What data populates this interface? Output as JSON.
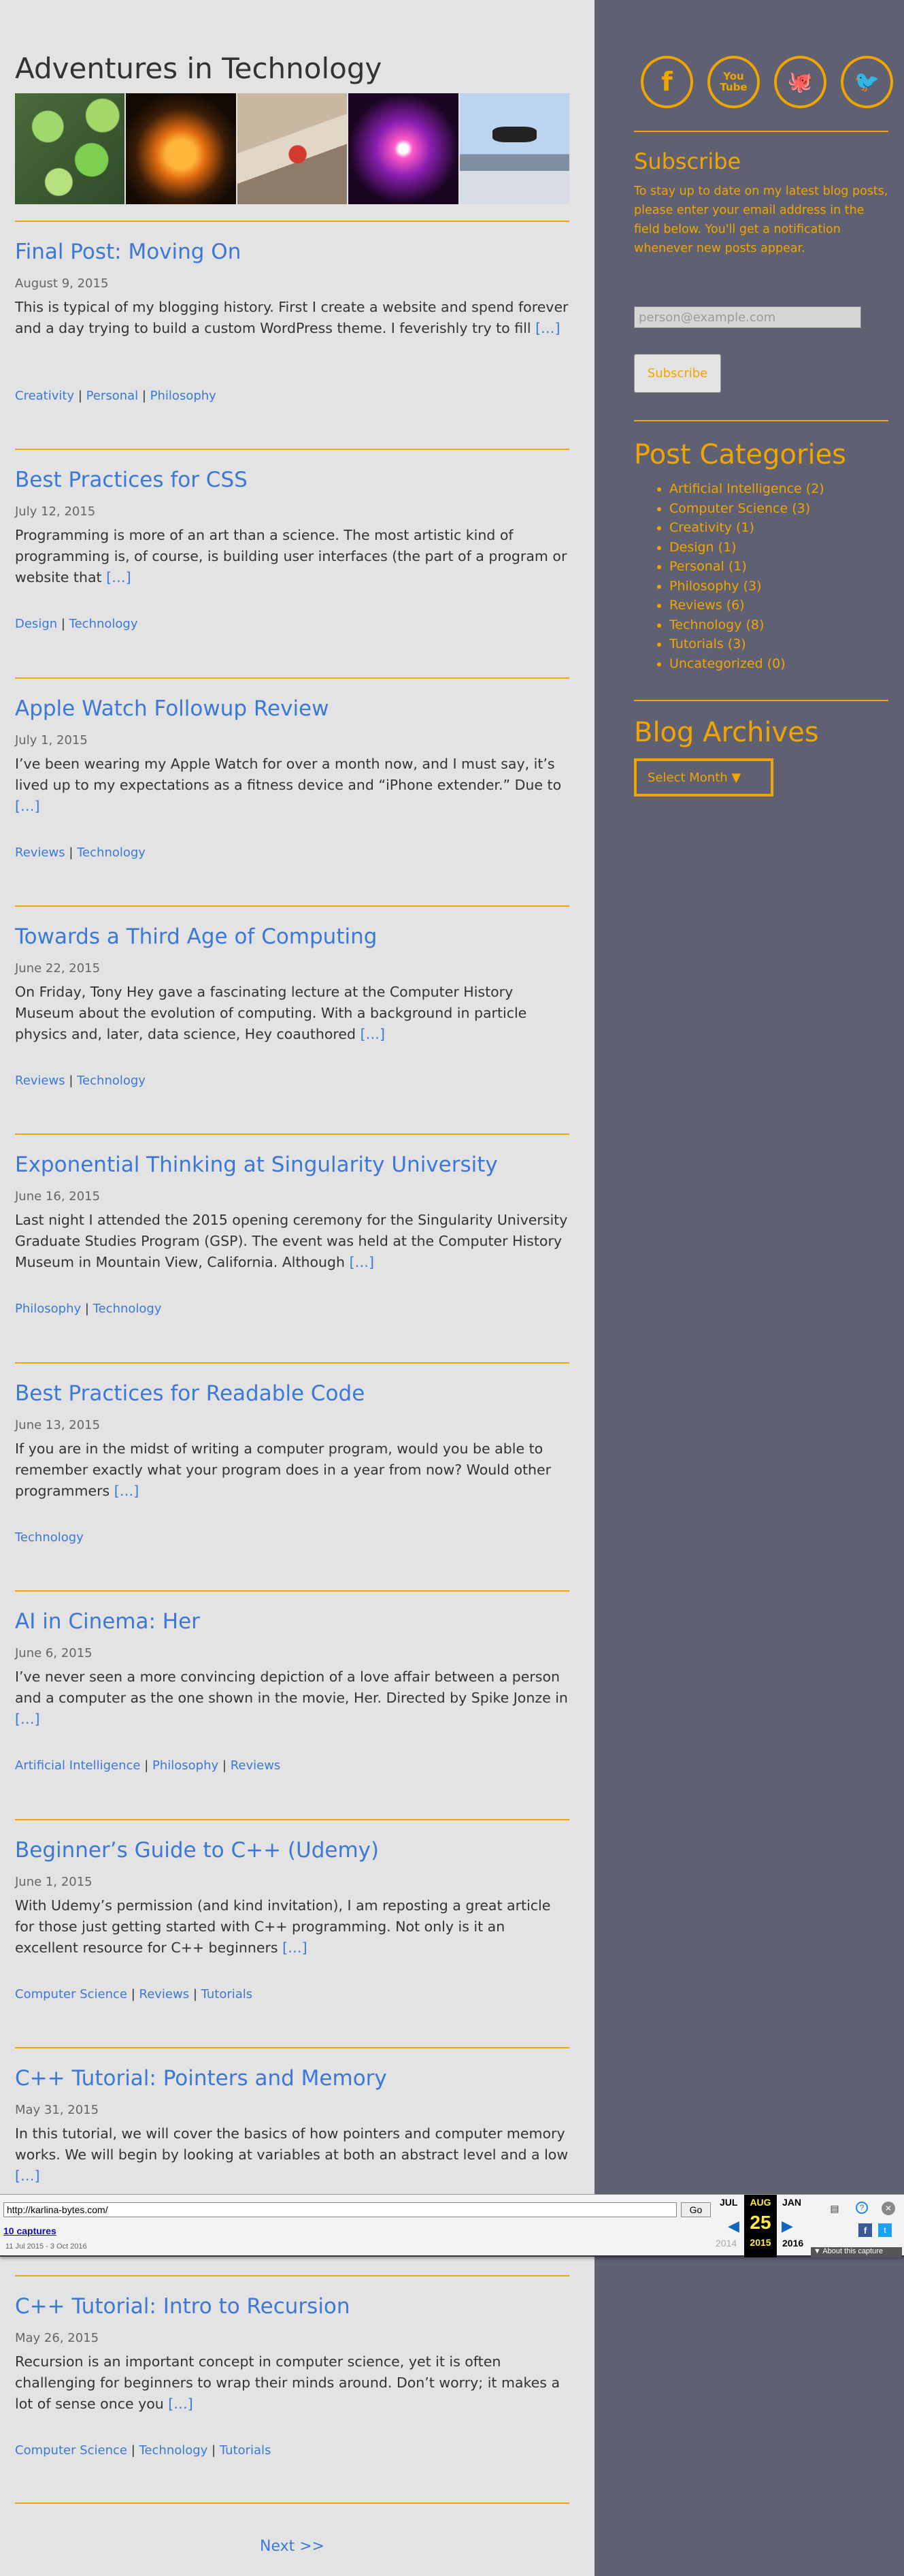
{
  "site": {
    "title": "Adventures in Technology"
  },
  "header_images": [
    "cells-image",
    "urchin-image",
    "fuse-image",
    "plasma-image",
    "drone-image"
  ],
  "posts": [
    {
      "title": "Final Post: Moving On",
      "date": "August 9, 2015",
      "excerpt": "This is typical of my blogging history. First I create a website and spend forever and a day trying to build a custom WordPress theme. I feverishly try to fill",
      "more": "[…]",
      "categories": [
        "Creativity",
        "Personal",
        "Philosophy"
      ]
    },
    {
      "title": "Best Practices for CSS",
      "date": "July 12, 2015",
      "excerpt": "Programming is more of an art than a science. The most artistic kind of programming is, of course, is building user interfaces (the part of a program or website that",
      "more": "[…]",
      "categories": [
        "Design",
        "Technology"
      ]
    },
    {
      "title": "Apple Watch Followup Review",
      "date": "July 1, 2015",
      "excerpt": "I’ve been wearing my Apple Watch for over a month now, and I must say, it’s lived up to my expectations as a fitness device and “iPhone extender.” Due to",
      "more": "[…]",
      "categories": [
        "Reviews",
        "Technology"
      ]
    },
    {
      "title": "Towards a Third Age of Computing",
      "date": "June 22, 2015",
      "excerpt": "On Friday, Tony Hey gave a fascinating lecture at the Computer History Museum about the evolution of computing. With a background in particle physics and, later, data science, Hey coauthored",
      "more": "[…]",
      "categories": [
        "Reviews",
        "Technology"
      ]
    },
    {
      "title": "Exponential Thinking at Singularity University",
      "date": "June 16, 2015",
      "excerpt": "Last night I attended the 2015 opening ceremony for the Singularity University Graduate Studies Program (GSP). The event was held at the Computer History Museum in Mountain View, California. Although",
      "more": "[…]",
      "categories": [
        "Philosophy",
        "Technology"
      ]
    },
    {
      "title": "Best Practices for Readable Code",
      "date": "June 13, 2015",
      "excerpt": "If you are in the midst of writing a computer program, would you be able to remember exactly what your program does in a year from now? Would other programmers",
      "more": "[…]",
      "categories": [
        "Technology"
      ]
    },
    {
      "title": "AI in Cinema: Her",
      "date": "June 6, 2015",
      "excerpt": "I’ve never seen a more convincing depiction of a love affair between a person and a computer as the one shown in the movie, Her. Directed by Spike Jonze in",
      "more": "[…]",
      "categories": [
        "Artificial Intelligence",
        "Philosophy",
        "Reviews"
      ]
    },
    {
      "title": "Beginner’s Guide to C++ (Udemy)",
      "date": "June 1, 2015",
      "excerpt": "With Udemy’s permission (and kind invitation), I am reposting a great article for those just getting started with C++ programming. Not only is it an excellent resource for C++ beginners",
      "more": "[…]",
      "categories": [
        "Computer Science",
        "Reviews",
        "Tutorials"
      ]
    },
    {
      "title": "C++ Tutorial: Pointers and Memory",
      "date": "May 31, 2015",
      "excerpt": "In this tutorial, we will cover the basics of how pointers and computer memory works. We will begin by looking at variables at both an abstract level and a low",
      "more": "[…]",
      "categories": []
    },
    {
      "title": "C++ Tutorial: Intro to Recursion",
      "date": "May 26, 2015",
      "excerpt": "Recursion is an important concept in computer science, yet it is often challenging for beginners to wrap their minds around. Don’t worry; it makes a lot of sense once you",
      "more": "[…]",
      "categories": [
        "Computer Science",
        "Technology",
        "Tutorials"
      ]
    }
  ],
  "pagination": {
    "next": "Next >>"
  },
  "sidebar": {
    "social": [
      {
        "icon": "facebook-icon",
        "glyph": "f"
      },
      {
        "icon": "youtube-icon",
        "glyph": "You\nTube"
      },
      {
        "icon": "github-icon",
        "glyph": "🐙"
      },
      {
        "icon": "twitter-icon",
        "glyph": "🐦"
      }
    ],
    "subscribe": {
      "heading": "Subscribe",
      "text": "To stay up to date on my latest blog posts, please enter your email address in the field below. You'll get a notification whenever new posts appear.",
      "placeholder": "person@example.com",
      "button": "Subscribe"
    },
    "categories": {
      "heading": "Post Categories",
      "items": [
        {
          "name": "Artificial Intelligence",
          "count": "(2)"
        },
        {
          "name": "Computer Science",
          "count": "(3)"
        },
        {
          "name": "Creativity",
          "count": "(1)"
        },
        {
          "name": "Design",
          "count": "(1)"
        },
        {
          "name": "Personal",
          "count": "(1)"
        },
        {
          "name": "Philosophy",
          "count": "(3)"
        },
        {
          "name": "Reviews",
          "count": "(6)"
        },
        {
          "name": "Technology",
          "count": "(8)"
        },
        {
          "name": "Tutorials",
          "count": "(3)"
        },
        {
          "name": "Uncategorized",
          "count": "(0)"
        }
      ]
    },
    "archives": {
      "heading": "Blog Archives",
      "select": "Select Month ▼"
    }
  },
  "wayback": {
    "url": "http://karlina-bytes.com/",
    "go": "Go",
    "captures": "10 captures",
    "range": "11 Jul 2015 - 3 Oct 2016",
    "prev_month": "JUL",
    "cur_month": "AUG",
    "cur_day": "25",
    "cur_year": "2015",
    "next_month": "JAN",
    "prev_year": "2014",
    "next_year": "2016",
    "about": "▼ About this capture"
  },
  "colors": {
    "accent": "#f0a500",
    "link": "#3b78d8",
    "sidebar_bg": "#5f6172",
    "main_bg": "#e3e3e3"
  }
}
